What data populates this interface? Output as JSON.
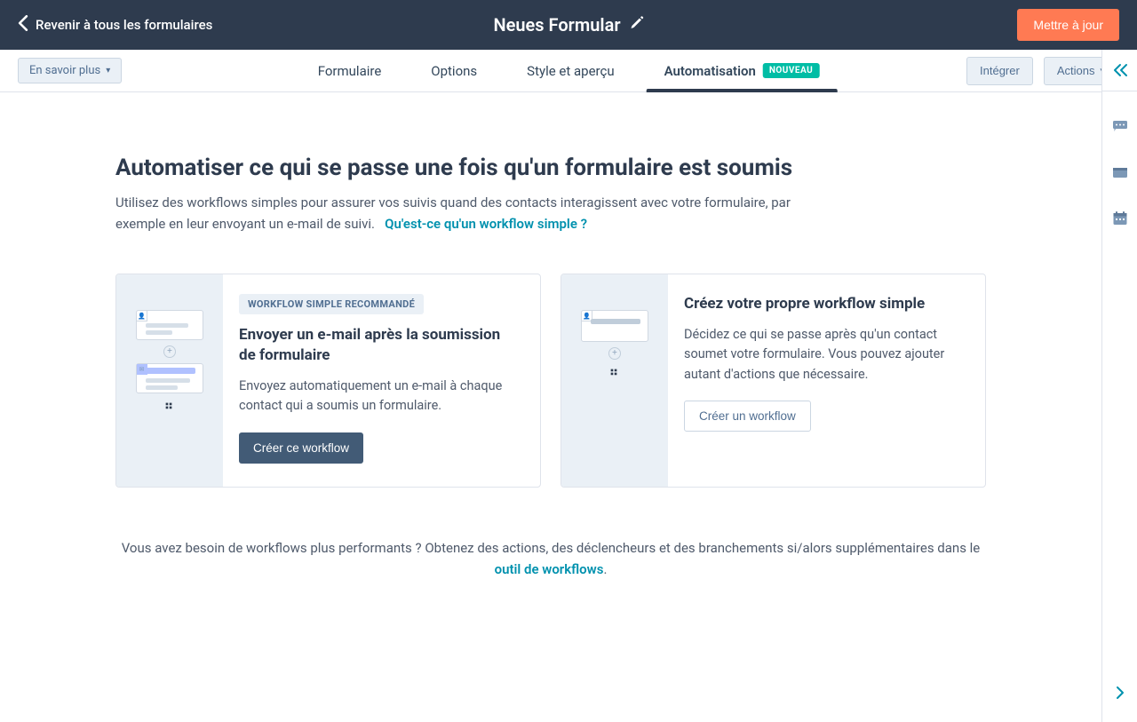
{
  "topbar": {
    "back_label": "Revenir à tous les formulaires",
    "title": "Neues Formular",
    "update_label": "Mettre à jour"
  },
  "subnav": {
    "learn_more": "En savoir plus",
    "tabs": {
      "form": "Formulaire",
      "options": "Options",
      "style": "Style et aperçu",
      "automation": "Automatisation",
      "new_badge": "NOUVEAU"
    },
    "integrate": "Intégrer",
    "actions": "Actions"
  },
  "main": {
    "heading": "Automatiser ce qui se passe une fois qu'un formulaire est soumis",
    "lead": "Utilisez des workflows simples pour assurer vos suivis quand des contacts interagissent avec votre formulaire, par exemple en leur envoyant un e-mail de suivi.",
    "lead_link": "Qu'est-ce qu'un workflow simple ?"
  },
  "card1": {
    "badge": "WORKFLOW SIMPLE RECOMMANDÉ",
    "title": "Envoyer un e-mail après la soumission de formulaire",
    "desc": "Envoyez automatiquement un e-mail à chaque contact qui a soumis un formulaire.",
    "button": "Créer ce workflow"
  },
  "card2": {
    "title": "Créez votre propre workflow simple",
    "desc": "Décidez ce qui se passe après qu'un contact soumet votre formulaire. Vous pouvez ajouter autant d'actions que nécessaire.",
    "button": "Créer un workflow"
  },
  "footer": {
    "text_before": "Vous avez besoin de workflows plus performants ? Obtenez des actions, des déclencheurs et des branchements si/alors supplémentaires dans le ",
    "link": "outil de workflows",
    "text_after": "."
  }
}
